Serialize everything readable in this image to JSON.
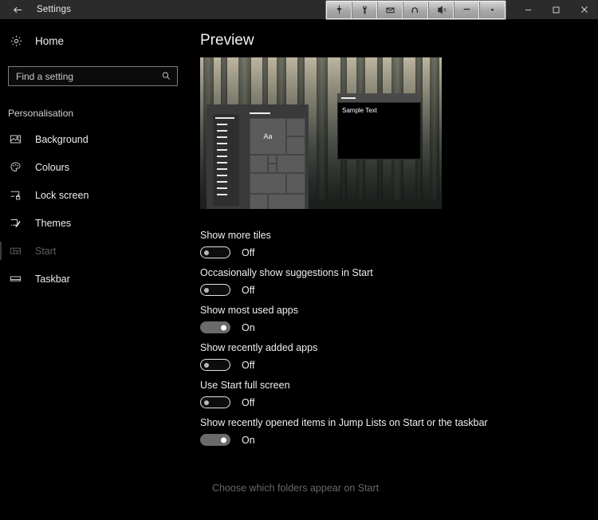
{
  "titlebar": {
    "back_icon": "back-arrow-icon",
    "title": "Settings",
    "minimize_label": "Minimise",
    "maximize_label": "Maximise",
    "close_label": "Close"
  },
  "capture_toolbar": {
    "buttons": [
      {
        "name": "capture-region-icon",
        "label": "Capture"
      },
      {
        "name": "tools-wrench-icon",
        "label": "Tools"
      },
      {
        "name": "save-image-icon",
        "label": "Save"
      },
      {
        "name": "undo-icon",
        "label": "Undo"
      },
      {
        "name": "send-to-icon",
        "label": "Send to"
      },
      {
        "name": "minimize-toolbar-icon",
        "label": "Minimise"
      },
      {
        "name": "more-options-icon",
        "label": "More"
      }
    ]
  },
  "sidebar": {
    "home": {
      "label": "Home",
      "icon": "gear-icon"
    },
    "search": {
      "placeholder": "Find a setting",
      "value": "",
      "icon": "search-icon"
    },
    "group_heading": "Personalisation",
    "items": [
      {
        "label": "Background",
        "icon": "picture-icon",
        "selected": false
      },
      {
        "label": "Colours",
        "icon": "palette-icon",
        "selected": false
      },
      {
        "label": "Lock screen",
        "icon": "lock-screen-icon",
        "selected": false
      },
      {
        "label": "Themes",
        "icon": "themes-brush-icon",
        "selected": false
      },
      {
        "label": "Start",
        "icon": "start-tiles-icon",
        "selected": true
      },
      {
        "label": "Taskbar",
        "icon": "taskbar-icon",
        "selected": false
      }
    ]
  },
  "main": {
    "page_title": "Preview",
    "preview": {
      "sample_window_text": "Sample Text",
      "tile_text": "Aa"
    },
    "settings": [
      {
        "label": "Show more tiles",
        "state": "Off",
        "on": false
      },
      {
        "label": "Occasionally show suggestions in Start",
        "state": "Off",
        "on": false
      },
      {
        "label": "Show most used apps",
        "state": "On",
        "on": true
      },
      {
        "label": "Show recently added apps",
        "state": "Off",
        "on": false
      },
      {
        "label": "Use Start full screen",
        "state": "Off",
        "on": false
      },
      {
        "label": "Show recently opened items in Jump Lists on Start or the taskbar",
        "state": "On",
        "on": true
      }
    ],
    "folders_link": "Choose which folders appear on Start"
  },
  "colors": {
    "window_background": "#000000",
    "titlebar": "#2b2b2b",
    "text_primary": "#f0f0f0",
    "text_dim": "#686868",
    "toggle_on": "#6a6a6a",
    "selection_bar": "#3a3a3a"
  }
}
